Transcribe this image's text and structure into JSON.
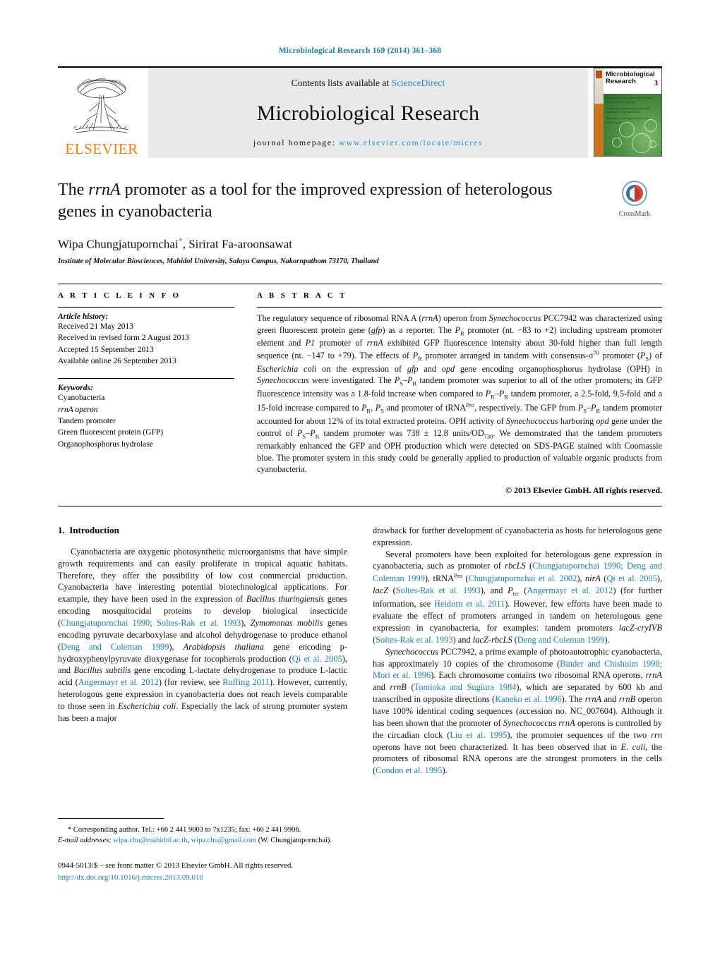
{
  "running_head": "Microbiological Research 169 (2014) 361–368",
  "masthead": {
    "publisher_name": "ELSEVIER",
    "contents_prefix": "Contents lists available at ",
    "contents_link": "ScienceDirect",
    "journal_name": "Microbiological Research",
    "homepage_prefix": "journal homepage: ",
    "homepage_url": "www.elsevier.com/locate/micres",
    "cover": {
      "title_line1": "Microbiological",
      "title_line2": "Research",
      "issue_number": "3",
      "bullets": [
        "Regulation of carbon and nitrogen fixation in heterocystous cyanobacteria",
        "Structure and genetic diversity of bacterial communities in agricultural soils",
        "Biosynthesis of antifungal metabolites by Bacillus species"
      ]
    }
  },
  "article": {
    "title_part1": "The ",
    "title_italic": "rrnA",
    "title_part2": " promoter as a tool for the improved expression of heterologous genes in cyanobacteria",
    "authors": "Wipa Chungjatupornchai",
    "author_marker": "*",
    "authors_rest": ", Sirirat Fa-aroonsawat",
    "affiliation": "Institute of Molecular Biosciences, Mahidol University, Salaya Campus, Nakornpathom 73170, Thailand",
    "crossmark_label": "CrossMark"
  },
  "article_info": {
    "heading": "A R T I C L E   I N F O",
    "history_label": "Article history:",
    "history": [
      "Received 21 May 2013",
      "Received in revised form 2 August 2013",
      "Accepted 15 September 2013",
      "Available online 26 September 2013"
    ],
    "keywords_label": "Keywords:",
    "keywords": [
      "Cyanobacteria",
      "rrnA operon",
      "Tandem promoter",
      "Green fluorescent protein (GFP)",
      "Organophosphorus hydrolase"
    ]
  },
  "abstract": {
    "heading": "A B S T R A C T",
    "text": "The regulatory sequence of ribosomal RNA A (rrnA) operon from Synechococcus PCC7942 was characterized using green fluorescent protein gene (gfp) as a reporter. The PR promoter (nt. −83 to +2) including upstream promoter element and P1 promoter of rrnA exhibited GFP fluorescence intensity about 30-fold higher than full length sequence (nt. −147 to +79). The effects of PR promoter arranged in tandem with consensus-σ70 promoter (PS) of Escherichia coli on the expression of gfp and opd gene encoding organophosphorus hydrolase (OPH) in Synechococcus were investigated. The PS–PR tandem promoter was superior to all of the other promoters; its GFP fluorescence intensity was a 1.8-fold increase when compared to PR–PR tandem promoter, a 2.5-fold, 9.5-fold and a 15-fold increase compared to PR, PS and promoter of tRNAPro, respectively. The GFP from PS–PR tandem promoter accounted for about 12% of its total extracted proteins. OPH activity of Synechococcus harboring opd gene under the control of PS–PR tandem promoter was 738 ± 12.8 units/OD730. We demonstrated that the tandem promoters remarkably enhanced the GFP and OPH production which were detected on SDS-PAGE stained with Coomassie blue. The promoter system in this study could be generally applied to production of valuable organic products from cyanobacteria.",
    "copyright": "© 2013 Elsevier GmbH. All rights reserved."
  },
  "introduction": {
    "section_number": "1.",
    "section_title": "Introduction",
    "left_paragraph_1": "Cyanobacteria are oxygenic photosynthetic microorganisms that have simple growth requirements and can easily proliferate in tropical aquatic habitats. Therefore, they offer the possibility of low cost commercial production. Cyanobacteria have interesting potential biotechnological applications. For example, they have been used in the expression of Bacillus thuringiensis genes encoding mosquitocidal proteins to develop biological insecticide (Chungjatupornchai 1990; Soltes-Rak et al. 1993), Zymomonas mobilis genes encoding pyruvate decarboxylase and alcohol dehydrogenase to produce ethanol (Deng and Coleman 1999), Arabidopsis thaliana gene encoding p-hydroxyphenylpyruvate dioxygenase for tocopherols production (Qi et al. 2005), and Bacillus subtilis gene encoding L-lactate dehydrogenase to produce L-lactic acid (Angermayr et al. 2012) (for review, see Ruffing 2011). However, currently, heterologous gene expression in cyanobacteria does not reach levels comparable to those seen in Escherichia coli. Especially the lack of strong promoter system has been a major drawback for further development of cyanobacteria as hosts for heterologous gene expression.",
    "right_paragraph_2": "Several promoters have been exploited for heterologous gene expression in cyanobacteria, such as promoter of rbcLS (Chungjatupornchai 1990; Deng and Coleman 1999), tRNAPro (Chungjatupornchai et al. 2002), nirA (Qi et al. 2005), lacZ (Soltes-Rak et al. 1993), and Ptrc (Angermayr et al. 2012) (for further information, see Heidorn et al. 2011). However, few efforts have been made to evaluate the effect of promoters arranged in tandem on heterologous gene expression in cyanobacteria, for examples: tandem promoters lacZ-cryIVB (Soltes-Rak et al. 1993) and lacZ-rbcLS (Deng and Coleman 1999).",
    "right_paragraph_3": "Synechococcus PCC7942, a prime example of photoautotrophic cyanobacteria, has approximately 10 copies of the chromosome (Binder and Chisholm 1990; Mori et al. 1996). Each chromosome contains two ribosomal RNA operons, rrnA and rrnB (Tomioka and Sugiura 1984), which are separated by 600 kb and transcribed in opposite directions (Kaneko et al. 1996). The rrnA and rrnB operon have 100% identical coding sequences (accession no. NC_007604). Although it has been shown that the promoter of Synechococcus rrnA operons is controlled by the circadian clock (Liu et al. 1995), the promoter sequences of the two rrn operons have not been characterized. It has been observed that in E. coli, the promoters of ribosomal RNA operons are the strongest promoters in the cells (Condon et al. 1995)."
  },
  "footnotes": {
    "corresponding_marker": "*",
    "corresponding_text": "Corresponding author. Tel.: +66 2 441 9003 to 7x1235; fax: +66 2 441 9906.",
    "email_label": "E-mail addresses:",
    "email_1": "wipa.chu@mahidol.ac.th",
    "email_2": "wipa.chu@gmail.com",
    "email_attrib": "(W. Chungjatupornchai).",
    "issn_line": "0944-5013/$ – see front matter © 2013 Elsevier GmbH. All rights reserved.",
    "doi": "http://dx.doi.org/10.1016/j.micres.2013.09.010"
  },
  "colors": {
    "link_blue": "#1a7eb0",
    "elsevier_orange": "#F07F1A",
    "box_gray": "#e9e9e9"
  }
}
